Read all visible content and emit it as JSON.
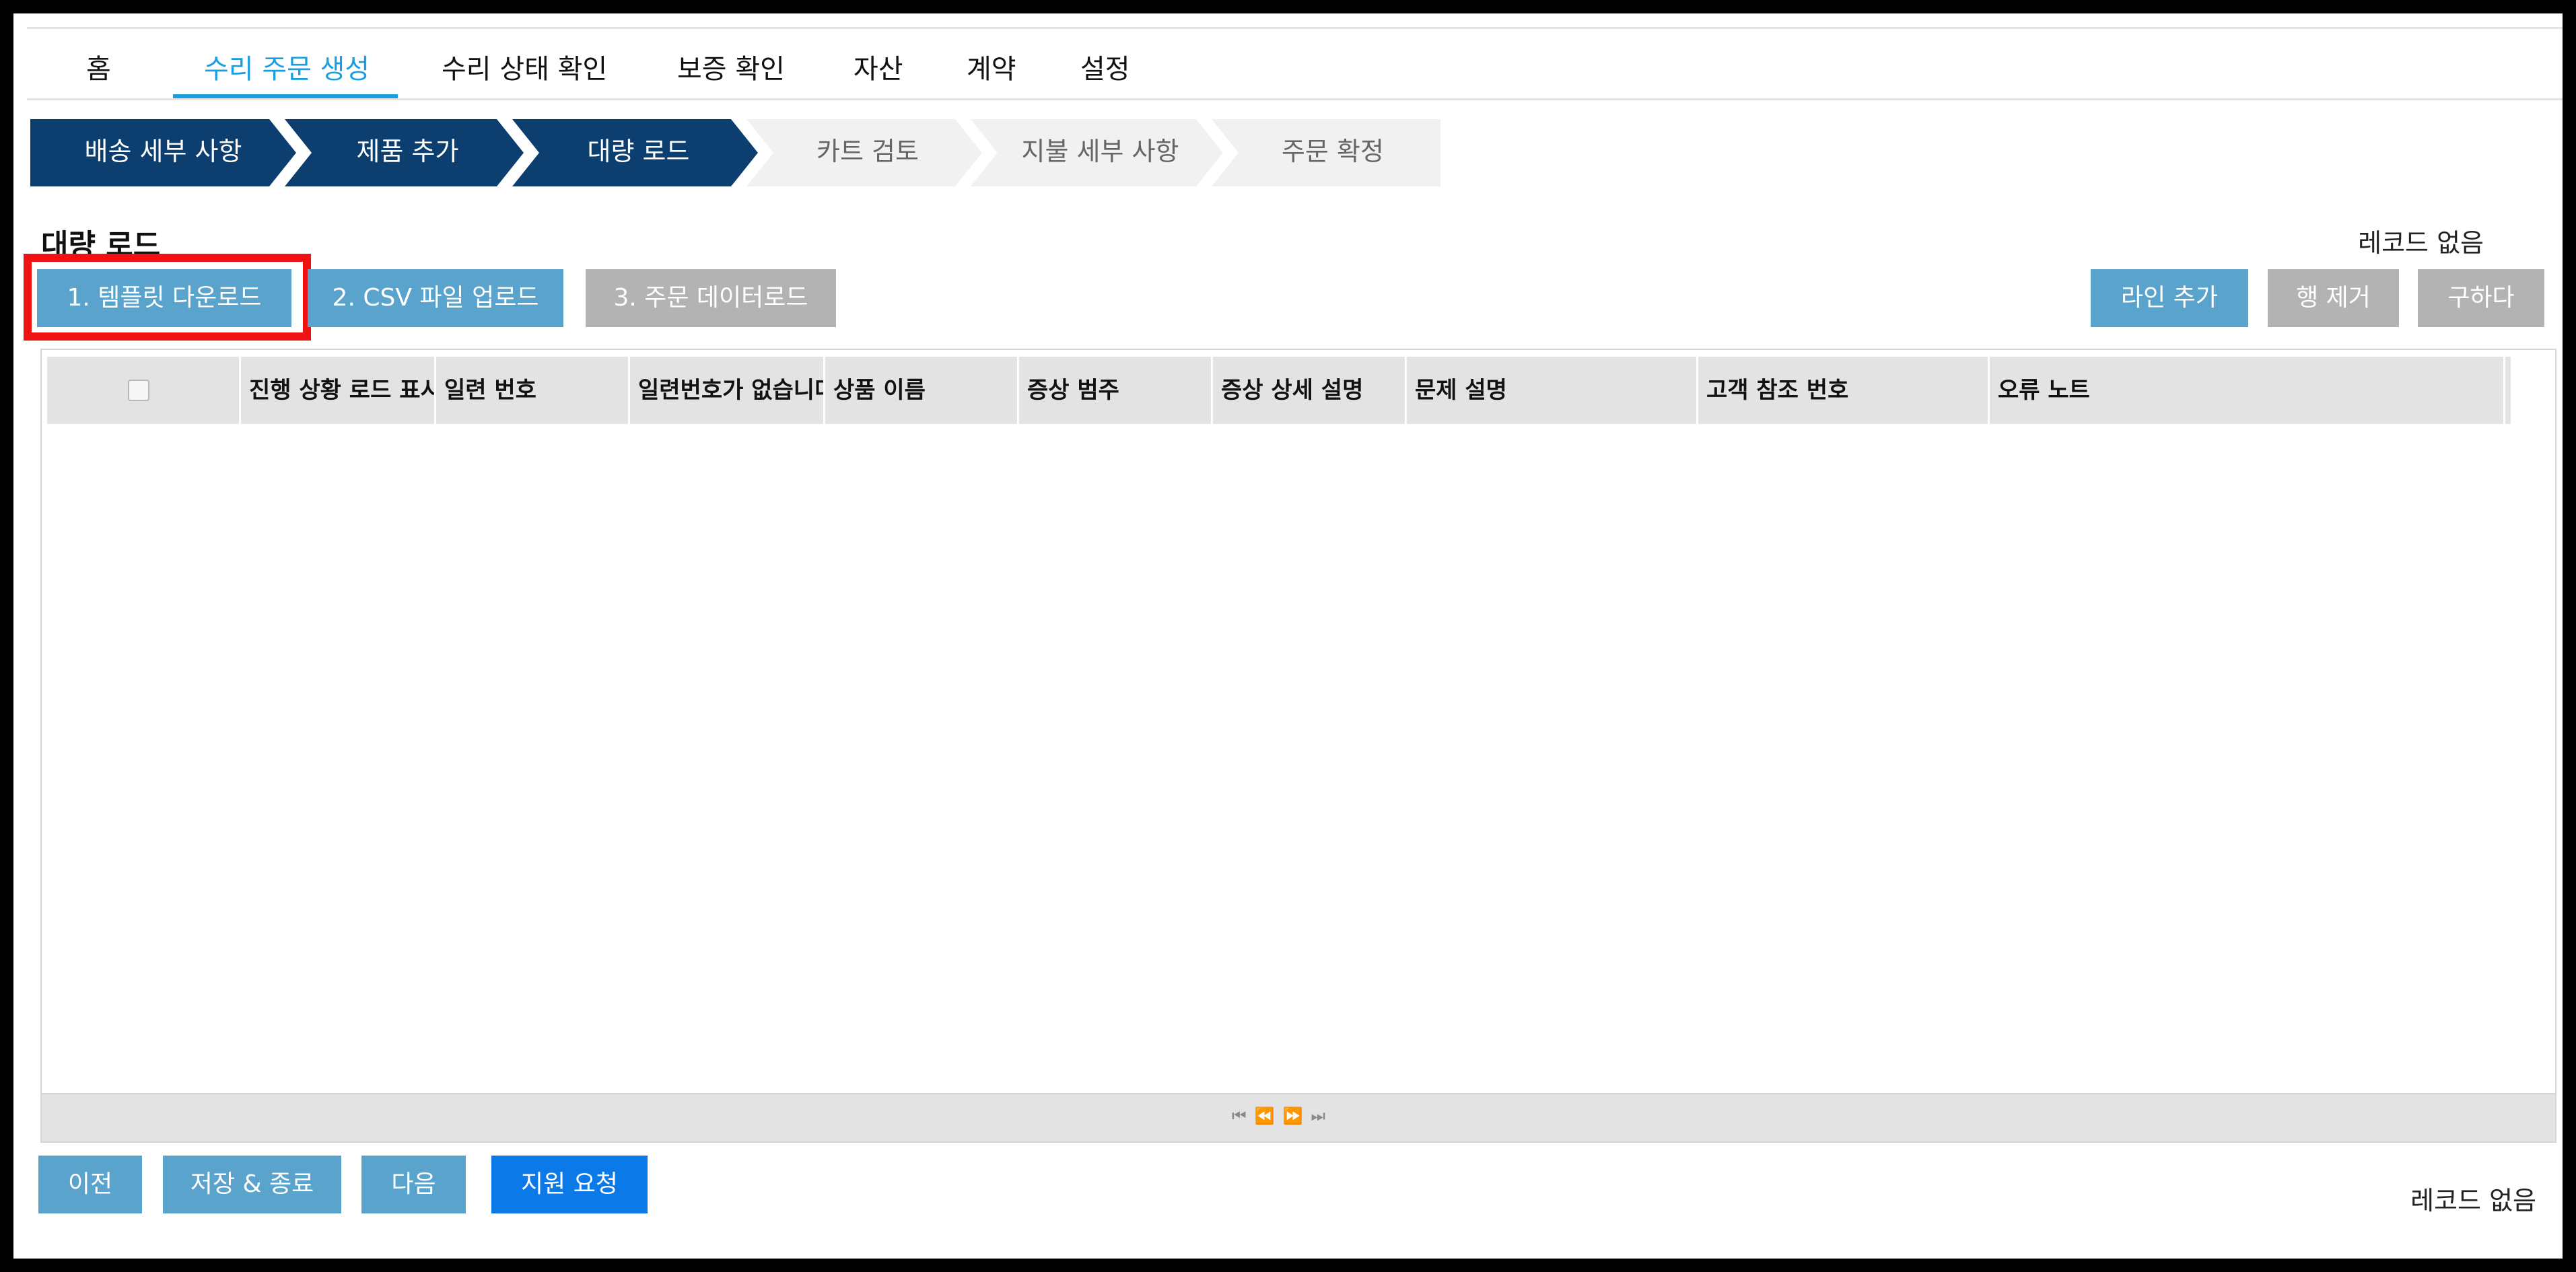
{
  "nav": {
    "items": [
      {
        "label": "홈"
      },
      {
        "label": "수리 주문 생성",
        "active": true
      },
      {
        "label": "수리 상태 확인"
      },
      {
        "label": "보증 확인"
      },
      {
        "label": "자산"
      },
      {
        "label": "계약"
      },
      {
        "label": "설정"
      }
    ]
  },
  "steps": [
    {
      "label": "배송 세부 사항",
      "state": "done"
    },
    {
      "label": "제품 추가",
      "state": "done"
    },
    {
      "label": "대량 로드",
      "state": "done"
    },
    {
      "label": "카트 검토",
      "state": "todo"
    },
    {
      "label": "지불 세부 사항",
      "state": "todo"
    },
    {
      "label": "주문 확정",
      "state": "todo"
    }
  ],
  "section": {
    "title": "대량 로드",
    "record_status": "레코드 없음"
  },
  "toolbar": {
    "download_template": "1. 템플릿 다운로드",
    "upload_csv": "2. CSV 파일 업로드",
    "load_order_data": "3. 주문 데이터로드",
    "add_line": "라인 추가",
    "remove_row": "행 제거",
    "get": "구하다"
  },
  "grid": {
    "columns": [
      "진행 상황 로드 표시",
      "일련 번호",
      "일련번호가 없습니다",
      "상품 이름",
      "증상 범주",
      "증상 상세 설명",
      "문제 설명",
      "고객 참조 번호",
      "오류 노트"
    ],
    "rows": [],
    "pager": {
      "first": "first-page-icon",
      "prev": "prev-page-icon",
      "next": "next-page-icon",
      "last": "last-page-icon"
    }
  },
  "footer": {
    "prev": "이전",
    "save_exit": "저장 & 종료",
    "next": "다음",
    "support": "지원 요청",
    "record_status": "레코드 없음"
  },
  "colors": {
    "step_done": "#0c3e70",
    "nav_active": "#1a9ee0",
    "button_blue": "#5aa3cc",
    "button_gray": "#b3b3b3",
    "button_primary": "#0b79e8",
    "highlight": "#ef1212"
  }
}
